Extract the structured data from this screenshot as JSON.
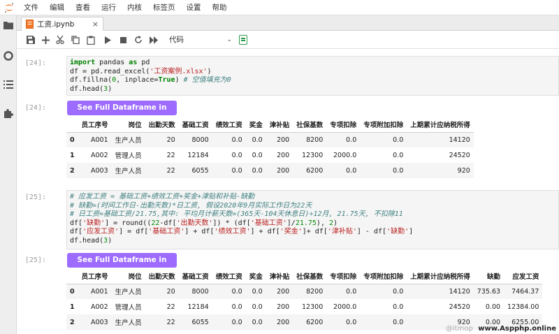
{
  "menubar": {
    "items": [
      "文件",
      "编辑",
      "查看",
      "运行",
      "内核",
      "标签页",
      "设置",
      "帮助"
    ]
  },
  "tab": {
    "title": "工资.ipynb",
    "close_glyph": "×"
  },
  "toolbar": {
    "cell_type": "代码",
    "caret": "⌄"
  },
  "cells": [
    {
      "prompt": "[24]:",
      "output_prompt": "[24]:",
      "mito_label": "See Full Dataframe in Mito",
      "table": {
        "columns": [
          "",
          "员工序号",
          "岗位",
          "出勤天数",
          "基础工资",
          "绩效工资",
          "奖金",
          "津补贴",
          "社保基数",
          "专项扣除",
          "专项附加扣除",
          "上期累计应纳税所得"
        ],
        "rows": [
          [
            "0",
            "A001",
            "生产人员",
            "20",
            "8000",
            "0.0",
            "0.0",
            "200",
            "8200",
            "0.0",
            "0.0",
            "14120"
          ],
          [
            "1",
            "A002",
            "管理人员",
            "22",
            "12184",
            "0.0",
            "0.0",
            "200",
            "12300",
            "2000.0",
            "0.0",
            "24520"
          ],
          [
            "2",
            "A003",
            "生产人员",
            "22",
            "6055",
            "0.0",
            "0.0",
            "200",
            "6200",
            "0.0",
            "0.0",
            "920"
          ]
        ]
      }
    },
    {
      "prompt": "[25]:",
      "output_prompt": "[25]:",
      "mito_label": "See Full Dataframe in Mito",
      "table": {
        "columns": [
          "",
          "员工序号",
          "岗位",
          "出勤天数",
          "基础工资",
          "绩效工资",
          "奖金",
          "津补贴",
          "社保基数",
          "专项扣除",
          "专项附加扣除",
          "上期累计应纳税所得",
          "缺勤",
          "应发工资"
        ],
        "rows": [
          [
            "0",
            "A001",
            "生产人员",
            "20",
            "8000",
            "0.0",
            "0.0",
            "200",
            "8200",
            "0.0",
            "0.0",
            "14120",
            "735.63",
            "7464.37"
          ],
          [
            "1",
            "A002",
            "管理人员",
            "22",
            "12184",
            "0.0",
            "0.0",
            "200",
            "12300",
            "2000.0",
            "0.0",
            "24520",
            "0.00",
            "12384.00"
          ],
          [
            "2",
            "A003",
            "生产人员",
            "22",
            "6055",
            "0.0",
            "0.0",
            "200",
            "6200",
            "0.0",
            "0.0",
            "920",
            "0.00",
            "6255.00"
          ]
        ]
      }
    }
  ],
  "watermark": {
    "faint": "@itmop",
    "site": "www.Aspphp.online"
  },
  "colors": {
    "mito_button": "#9d6cff",
    "kernel_idle": "#2e9b50",
    "code_keyword": "#008000",
    "code_string": "#ba2121",
    "code_comment": "#408080"
  }
}
